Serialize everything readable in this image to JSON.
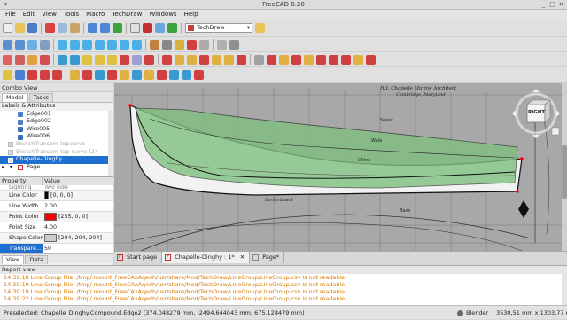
{
  "window": {
    "title": "FreeCAD 0.20"
  },
  "menu": [
    "File",
    "Edit",
    "View",
    "Tools",
    "Macro",
    "TechDraw",
    "Windows",
    "Help"
  ],
  "toolbar": {
    "workbench": "TechDraw"
  },
  "combo_view": {
    "title": "Combo View",
    "tabs": [
      "Model",
      "Tasks"
    ],
    "labels_header": "Labels & Attributes",
    "tree": [
      {
        "label": "Edge001",
        "icon": "edge-icon",
        "greyed": false,
        "selected": false
      },
      {
        "label": "Edge002",
        "icon": "edge-icon",
        "greyed": false,
        "selected": false
      },
      {
        "label": "Wire005",
        "icon": "wire-icon",
        "greyed": false,
        "selected": false
      },
      {
        "label": "Wire006",
        "icon": "wire-icon",
        "greyed": false,
        "selected": false
      },
      {
        "label": "SketchTransom-topcurve",
        "icon": "sketch-icon",
        "greyed": true,
        "selected": false
      },
      {
        "label": "SketchTransom-top-curve (2)",
        "icon": "sketch-icon",
        "greyed": true,
        "selected": false
      },
      {
        "label": "Chapelle-Dinghy",
        "icon": "drawing-icon",
        "greyed": false,
        "selected": true
      },
      {
        "label": "Page",
        "icon": "page-icon",
        "greyed": false,
        "selected": false
      }
    ],
    "property_headers": [
      "Property",
      "Value"
    ],
    "properties": [
      {
        "name": "Lighting",
        "value": "Two side",
        "swatch": ""
      },
      {
        "name": "Line Color",
        "value": "[0, 0, 0]",
        "swatch": "#000000"
      },
      {
        "name": "Line Width",
        "value": "2.00",
        "swatch": ""
      },
      {
        "name": "Point Color",
        "value": "[255, 0, 0]",
        "swatch": "#ff0000"
      },
      {
        "name": "Point Size",
        "value": "4.00",
        "swatch": ""
      },
      {
        "name": "Shape Color",
        "value": "[204, 204, 204]",
        "swatch": "#cccccc"
      },
      {
        "name": "Transpare...",
        "value": "50",
        "swatch": ""
      }
    ],
    "bottom_tabs": [
      "View",
      "Data"
    ]
  },
  "viewport": {
    "navcube_face": "RIGHT",
    "drawing_text": {
      "line1": "H.I. Chapelle Marine Architect",
      "line2": "Cambridge, Maryland",
      "sheer": "Sheer",
      "wale": "Wale",
      "chine": "Chine",
      "centerboard": "Centerboard",
      "base": "Base"
    }
  },
  "doc_tabs": [
    {
      "label": "Start page",
      "selected": false
    },
    {
      "label": "Chapelle-Dinghy : 1*",
      "selected": true
    },
    {
      "label": "Page*",
      "selected": false
    }
  ],
  "report_view": {
    "title": "Report view",
    "lines": [
      "14:39:18  Line Group File: /tmp/.mount_FreeCAxAqedh/usr/share/Mod/TechDraw/LineGroup/LineGroup.csv is not readable",
      "14:39:19  Line Group File: /tmp/.mount_FreeCAxAqedh/usr/share/Mod/TechDraw/LineGroup/LineGroup.csv is not readable",
      "14:39:19  Line Group File: /tmp/.mount_FreeCAxAqedh/usr/share/Mod/TechDraw/LineGroup/LineGroup.csv is not readable",
      "14:39:22  Line Group File: /tmp/.mount_FreeCAxAqedh/usr/share/Mod/TechDraw/LineGroup/LineGroup.csv is not readable"
    ]
  },
  "status_bar": {
    "preselected": "Preselected: Chapelle_Dinghy.Compound.Edge2 (374.048279 mm, -2494.644043 mm, 675.128479 mm)",
    "nav_style": "Blender",
    "dimensions": "3530,51 mm x 1303,77 mm"
  },
  "colors": {
    "selection": "#1f6fd0",
    "hull_fill": "#7fbf7f",
    "error_text": "#d97a00"
  }
}
